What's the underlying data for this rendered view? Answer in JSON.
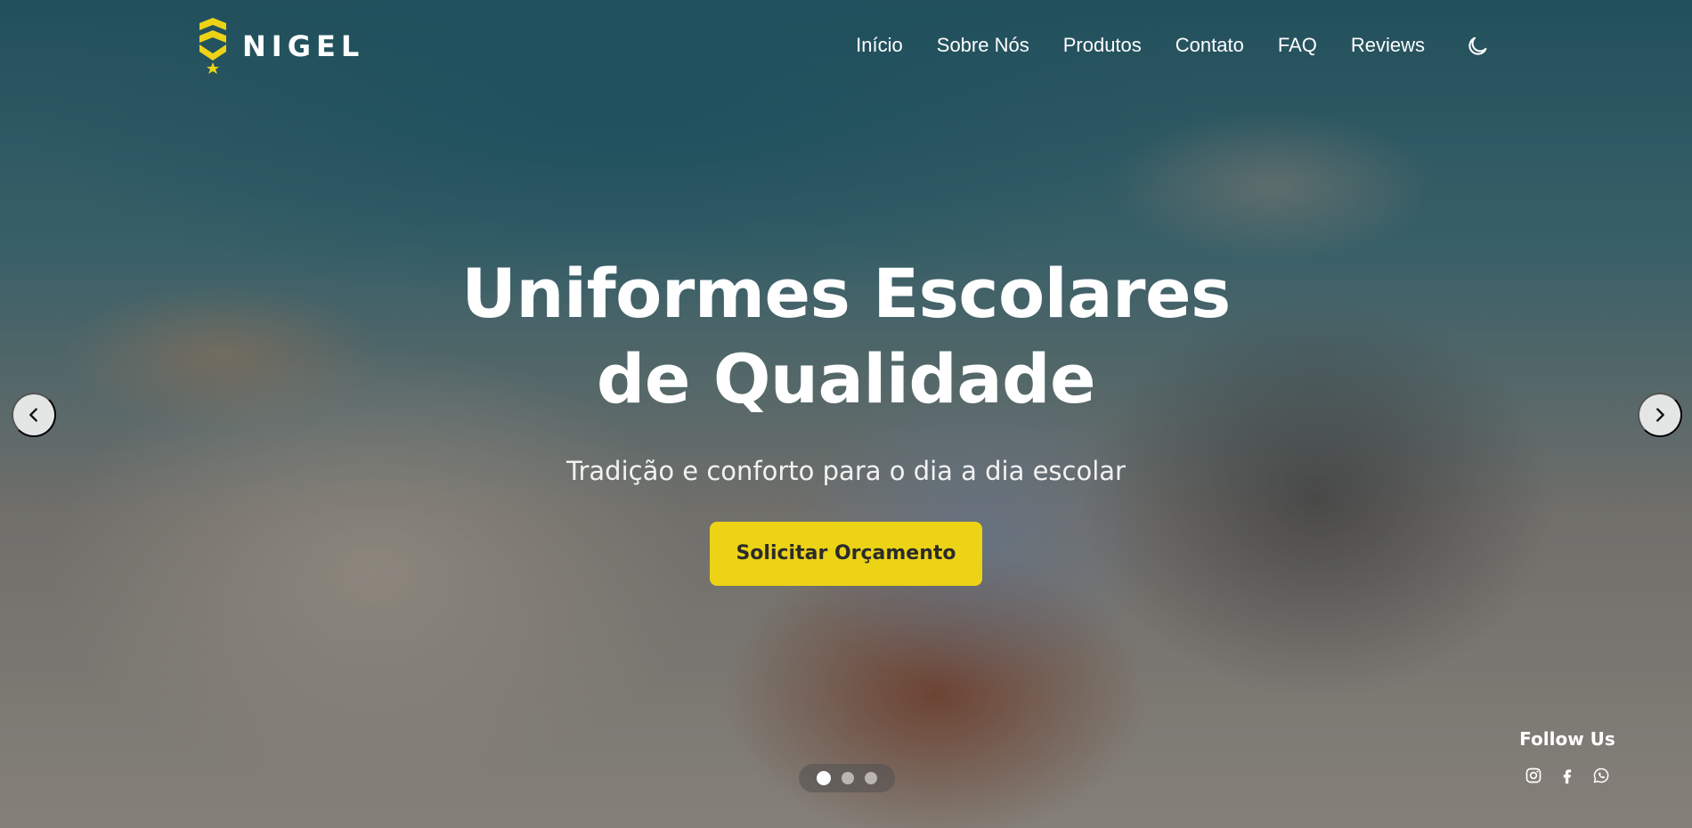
{
  "brand": {
    "name": "NIGEL",
    "accent_color": "#ecd316"
  },
  "nav": {
    "items": [
      {
        "label": "Início"
      },
      {
        "label": "Sobre Nós"
      },
      {
        "label": "Produtos"
      },
      {
        "label": "Contato"
      },
      {
        "label": "FAQ"
      },
      {
        "label": "Reviews"
      }
    ],
    "theme_toggle_icon": "moon-icon"
  },
  "hero": {
    "title_line1": "Uniformes Escolares",
    "title_line2": "de Qualidade",
    "subtitle": "Tradição e conforto para o dia a dia escolar",
    "cta_label": "Solicitar Orçamento"
  },
  "carousel": {
    "prev_icon": "chevron-left-icon",
    "next_icon": "chevron-right-icon",
    "slide_count": 3,
    "active_slide": 1
  },
  "social": {
    "title": "Follow Us",
    "icons": [
      "instagram-icon",
      "facebook-icon",
      "whatsapp-icon"
    ]
  }
}
